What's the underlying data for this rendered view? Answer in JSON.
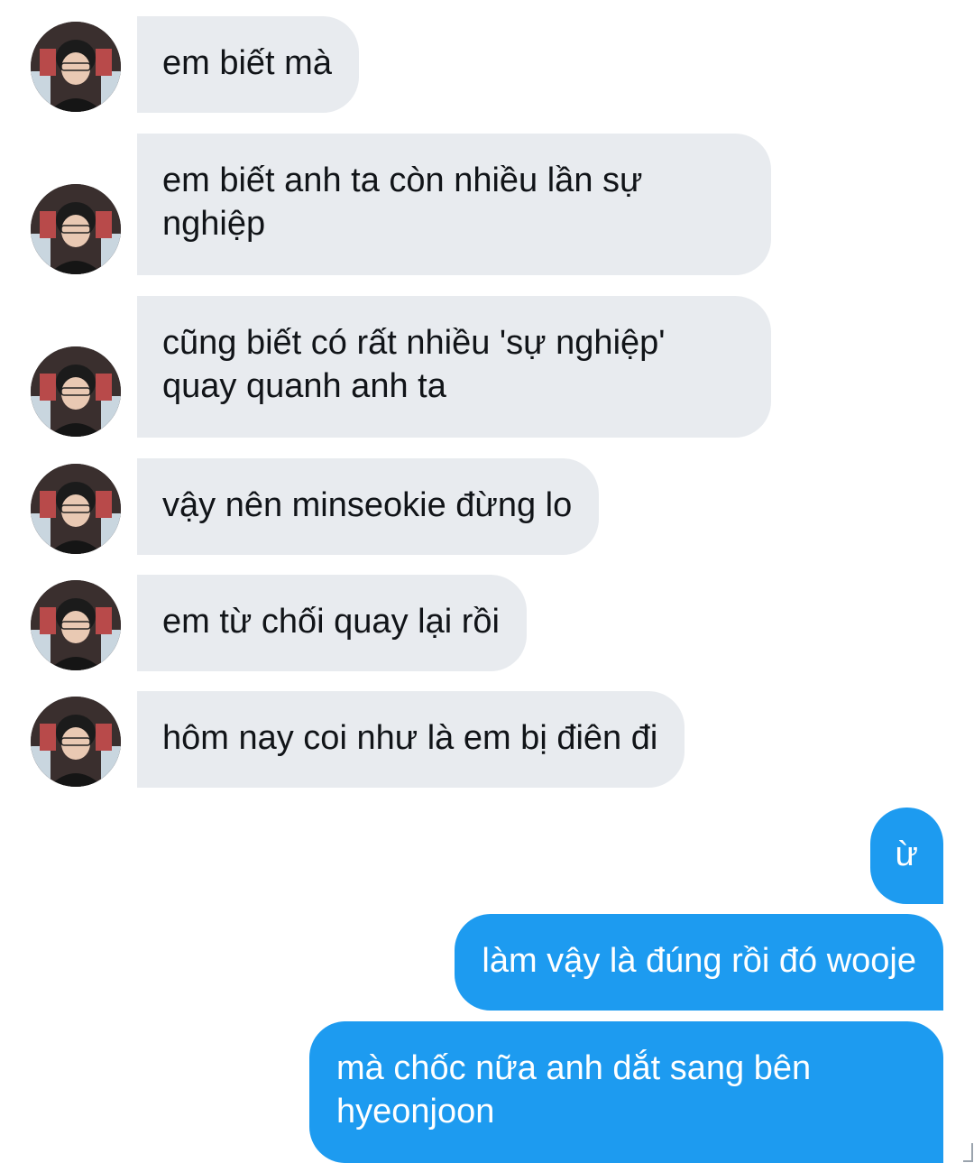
{
  "conversation": {
    "incoming": [
      {
        "text": "em biết mà"
      },
      {
        "text": "em biết anh ta còn nhiều lần sự\nnghiệp"
      },
      {
        "text": "cũng biết có rất nhiều 'sự nghiệp'\nquay quanh anh ta"
      },
      {
        "text": "vậy nên minseokie đừng lo"
      },
      {
        "text": "em từ chối quay lại rồi"
      },
      {
        "text": "hôm nay coi như là em bị điên đi"
      }
    ],
    "outgoing": [
      {
        "text": "ừ"
      },
      {
        "text": "làm vậy là đúng rồi đó wooje"
      },
      {
        "text": "mà chốc nữa anh dắt sang bên\nhyeonjoon"
      }
    ]
  },
  "colors": {
    "incoming_bubble": "#e8ebef",
    "outgoing_bubble": "#1d9bf0",
    "background": "#ffffff"
  },
  "icons": {
    "avatar": "user-avatar-photo"
  }
}
